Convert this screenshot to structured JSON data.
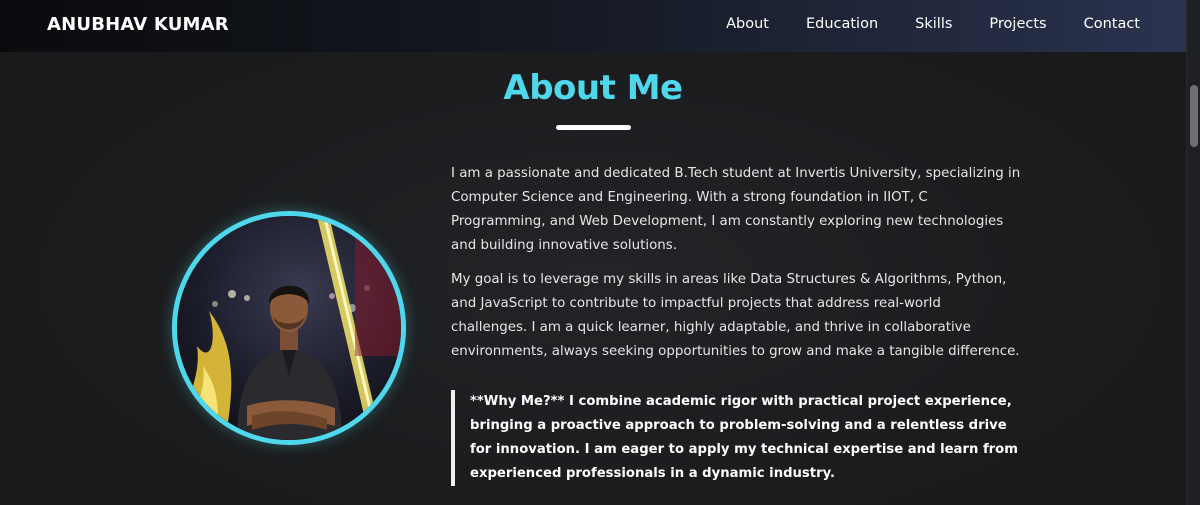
{
  "navbar": {
    "brand": "ANUBHAV KUMAR",
    "links": [
      "About",
      "Education",
      "Skills",
      "Projects",
      "Contact"
    ]
  },
  "about": {
    "title": "About Me",
    "paragraphs": [
      "I am a passionate and dedicated B.Tech student at Invertis University, specializing in Computer Science and Engineering. With a strong foundation in IIOT, C Programming, and Web Development, I am constantly exploring new technologies and building innovative solutions.",
      "My goal is to leverage my skills in areas like Data Structures & Algorithms, Python, and JavaScript to contribute to impactful projects that address real-world challenges. I am a quick learner, highly adaptable, and thrive in collaborative environments, always seeking opportunities to grow and make a tangible difference."
    ],
    "highlight": "**Why Me?** I combine academic rigor with practical project experience, bringing a proactive approach to problem-solving and a relentless drive for innovation. I am eager to apply my technical expertise and learn from experienced professionals in a dynamic industry."
  },
  "colors": {
    "accent": "#4fd8ec",
    "background": "#1a1b1d",
    "text": "#e6e6e6"
  }
}
